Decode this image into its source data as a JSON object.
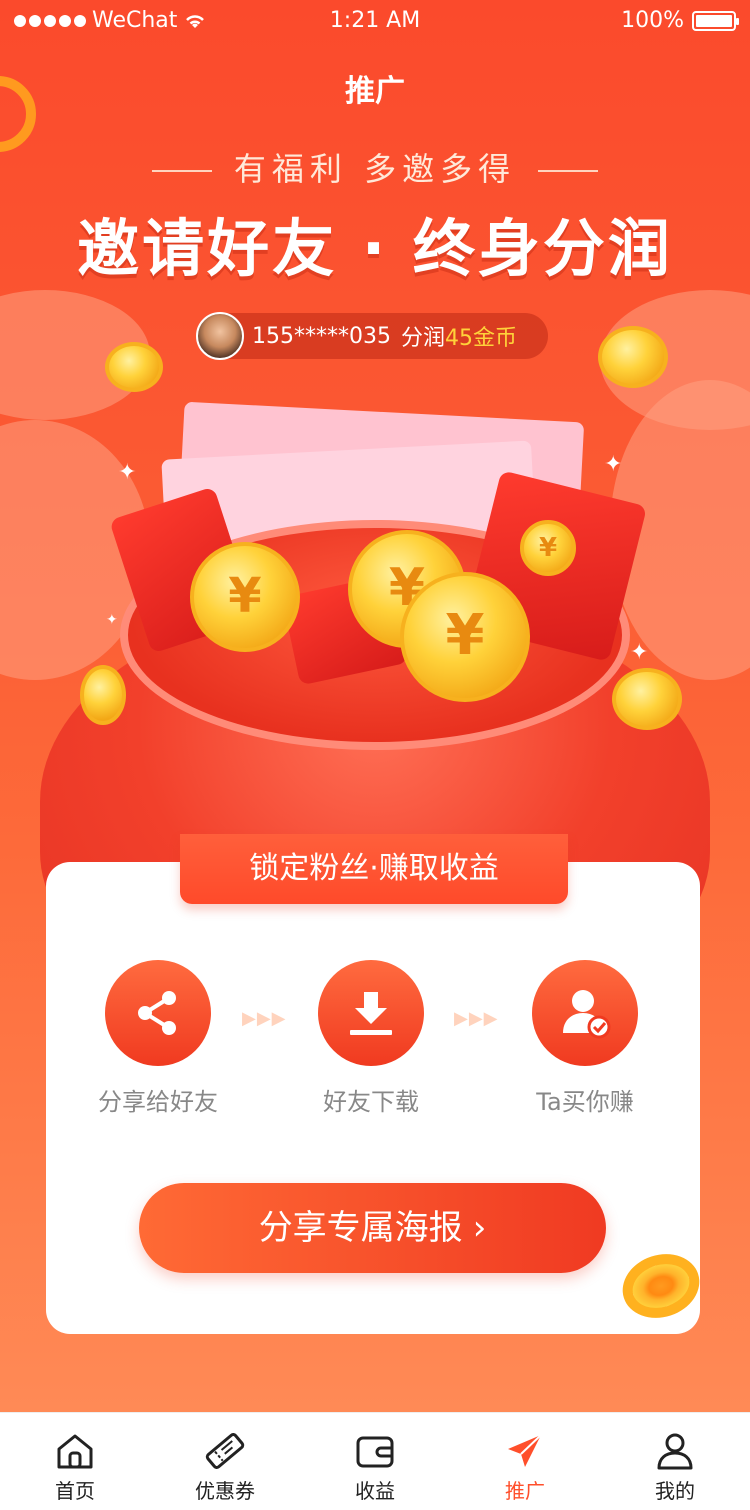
{
  "status_bar": {
    "carrier": "WeChat",
    "time": "1:21 AM",
    "battery": "100%"
  },
  "header": {
    "title": "推广"
  },
  "hero": {
    "subtitle": "有福利 多邀多得",
    "headline": "邀请好友 · 终身分润"
  },
  "ticker": {
    "phone": "155*****035",
    "text": "分润",
    "amount": "45金币"
  },
  "card": {
    "banner": "锁定粉丝·赚取收益",
    "steps": [
      {
        "label": "分享给好友",
        "icon": "share-icon"
      },
      {
        "label": "好友下载",
        "icon": "download-icon"
      },
      {
        "label": "Ta买你赚",
        "icon": "user-check-icon"
      }
    ],
    "cta": "分享专属海报"
  },
  "tabbar": {
    "items": [
      {
        "label": "首页",
        "icon": "home-icon"
      },
      {
        "label": "优惠券",
        "icon": "ticket-icon"
      },
      {
        "label": "收益",
        "icon": "wallet-icon"
      },
      {
        "label": "推广",
        "icon": "send-icon",
        "active": true
      },
      {
        "label": "我的",
        "icon": "user-icon"
      }
    ]
  },
  "colors": {
    "primary": "#fb4a2c",
    "accent_gold": "#ffd23a",
    "active_tab": "#ff4f2b"
  }
}
